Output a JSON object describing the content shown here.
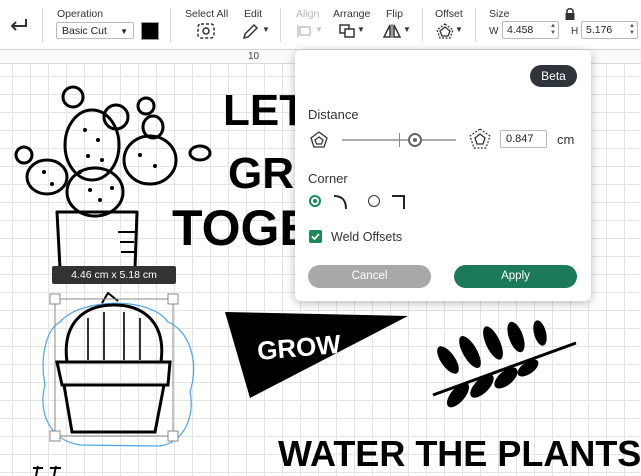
{
  "toolbar": {
    "operation_label": "Operation",
    "operation_value": "Basic Cut",
    "select_all_label": "Select All",
    "edit_label": "Edit",
    "align_label": "Align",
    "arrange_label": "Arrange",
    "flip_label": "Flip",
    "offset_label": "Offset",
    "size_label": "Size",
    "width_label": "W",
    "width_value": "4.458",
    "height_label": "H",
    "height_value": "5.176",
    "swatch_color": "#000000"
  },
  "ruler": {
    "mark": "10"
  },
  "selection": {
    "dimensions": "4.46  cm x 5.18  cm"
  },
  "canvas_text": {
    "lets_grow_together": [
      "LET",
      "GRO",
      "TOGET"
    ],
    "pennant": "GROW",
    "bottom_phrase": "WATER THE PLANTS"
  },
  "offset_panel": {
    "beta_badge": "Beta",
    "distance_label": "Distance",
    "distance_value": "0.847",
    "distance_unit": "cm",
    "distance_fraction": 0.65,
    "corner_label": "Corner",
    "corner_selected": "rounded",
    "weld_label": "Weld Offsets",
    "weld_checked": true,
    "cancel_label": "Cancel",
    "apply_label": "Apply",
    "accent_color": "#1b7a57"
  }
}
